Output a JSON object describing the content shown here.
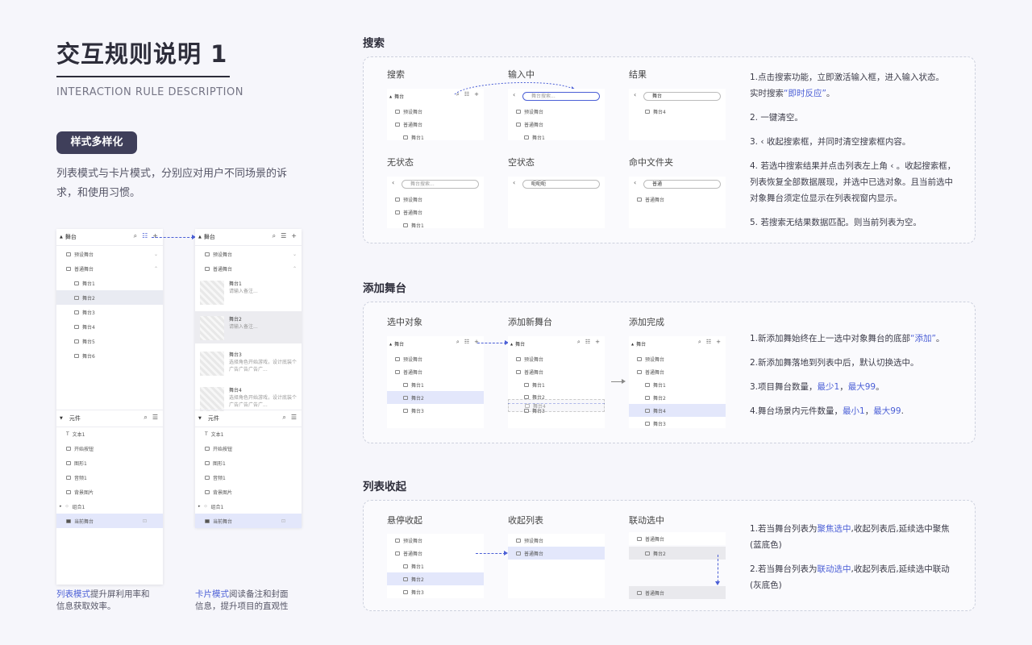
{
  "header": {
    "title": "交互规则说明 1",
    "subtitle": "INTERACTION RULE DESCRIPTION"
  },
  "intro": {
    "tag": "样式多样化",
    "description": "列表模式与卡片模式，分别应对用户不同场景的诉求，和使用习惯。"
  },
  "list_mode": {
    "header_title": "舞台",
    "rows": [
      "预设舞台",
      "普通舞台",
      "舞台1",
      "舞台2",
      "舞台3",
      "舞台4",
      "舞台5",
      "舞台6"
    ],
    "component_header": "元件",
    "components": [
      "文本1",
      "开始按钮",
      "图形1",
      "音频1",
      "背景图片",
      "组合1",
      "当前舞台"
    ],
    "caption_blue": "列表模式",
    "caption_rest1": "提升屏利用率和",
    "caption_rest2": "信息获取效率。"
  },
  "card_mode": {
    "header_title": "舞台",
    "rows": [
      "预设舞台",
      "普通舞台"
    ],
    "cards": [
      {
        "title": "舞台1",
        "note": "请输入备注..."
      },
      {
        "title": "舞台2",
        "note": "请输入备注..."
      },
      {
        "title": "舞台3",
        "note": "选择角色开始游戏，设计底装个广告广告广告广..."
      },
      {
        "title": "舞台4",
        "note": "选择角色开始游戏，设计底装个广告广告广告广..."
      }
    ],
    "component_header": "元件",
    "components": [
      "文本1",
      "开始按钮",
      "图形1",
      "音频1",
      "背景图片",
      "组合1",
      "当前舞台"
    ],
    "caption_blue": "卡片模式",
    "caption_rest1": "阅读备注和封面",
    "caption_rest2": "信息，提升项目的直观性"
  },
  "search": {
    "heading": "搜索",
    "labels": [
      "搜索",
      "输入中",
      "结果",
      "无状态",
      "空状态",
      "命中文件夹"
    ],
    "stage_title": "舞台",
    "preset": "预设舞台",
    "normal": "普通舞台",
    "stage1": "舞台1",
    "stage4": "舞台4",
    "placeholder_typing": "舞台搜索...",
    "query_result": "舞台",
    "placeholder_none": "舞台搜索...",
    "query_empty": "呃呃呃",
    "query_folder": "普通",
    "notes": {
      "n1a": "1.点击搜索功能，立即激活输入框，进入输入状态。",
      "n1b_pre": "实时搜索",
      "n1b_blue": "“即时反应”",
      "n1b_post": "。",
      "n2": "2.      一键清空。",
      "n3": "3.  ‹  收起搜索框，并同时清空搜索框内容。",
      "n4": "4. 若选中搜索结果并点击列表左上角 ‹ 。收起搜索框，列表恢复全部数据展现，并选中已选对象。且当前选中对象舞台须定位显示在列表视窗内显示。",
      "n5": "5. 若搜索无结果数据匹配。则当前列表为空。"
    }
  },
  "add": {
    "heading": "添加舞台",
    "labels": [
      "选中对象",
      "添加新舞台",
      "添加完成"
    ],
    "stage_title": "舞台",
    "preset": "预设舞台",
    "normal": "普通舞台",
    "stages": [
      "舞台1",
      "舞台2",
      "舞台3",
      "舞台4"
    ],
    "notes": {
      "n1_pre": "1.新添加舞始终在上一选中对象舞台的底部",
      "n1_blue": "“添加”",
      "n1_post": "。",
      "n2": "2.新添加舞落地到列表中后，默认切换选中。",
      "n3_pre": "3.项目舞台数量，",
      "n3_b1": "最少1",
      "n3_mid": "，",
      "n3_b2": "最大99",
      "n3_post": "。",
      "n4_pre": "4.舞台场景内元件数量，",
      "n4_b1": "最小1",
      "n4_mid": "，",
      "n4_b2": "最大99",
      "n4_post": "."
    }
  },
  "collapse": {
    "heading": "列表收起",
    "labels": [
      "悬停收起",
      "收起列表",
      "联动选中"
    ],
    "preset": "预设舞台",
    "normal": "普通舞台",
    "stages": [
      "舞台1",
      "舞台2",
      "舞台3"
    ],
    "notes": {
      "n1_pre": "1.若当舞台列表为",
      "n1_blue": "聚焦选中",
      "n1_post": ",收起列表后,延续选中聚焦(蓝底色)",
      "n2_pre": "2.若当舞台列表为",
      "n2_blue": "联动选中",
      "n2_post": ",收起列表后,延续选中联动(灰底色)"
    }
  },
  "colors": {
    "accent": "#4b5fd6",
    "dark": "#3f3f5a",
    "selection": "#e3e7fb"
  }
}
